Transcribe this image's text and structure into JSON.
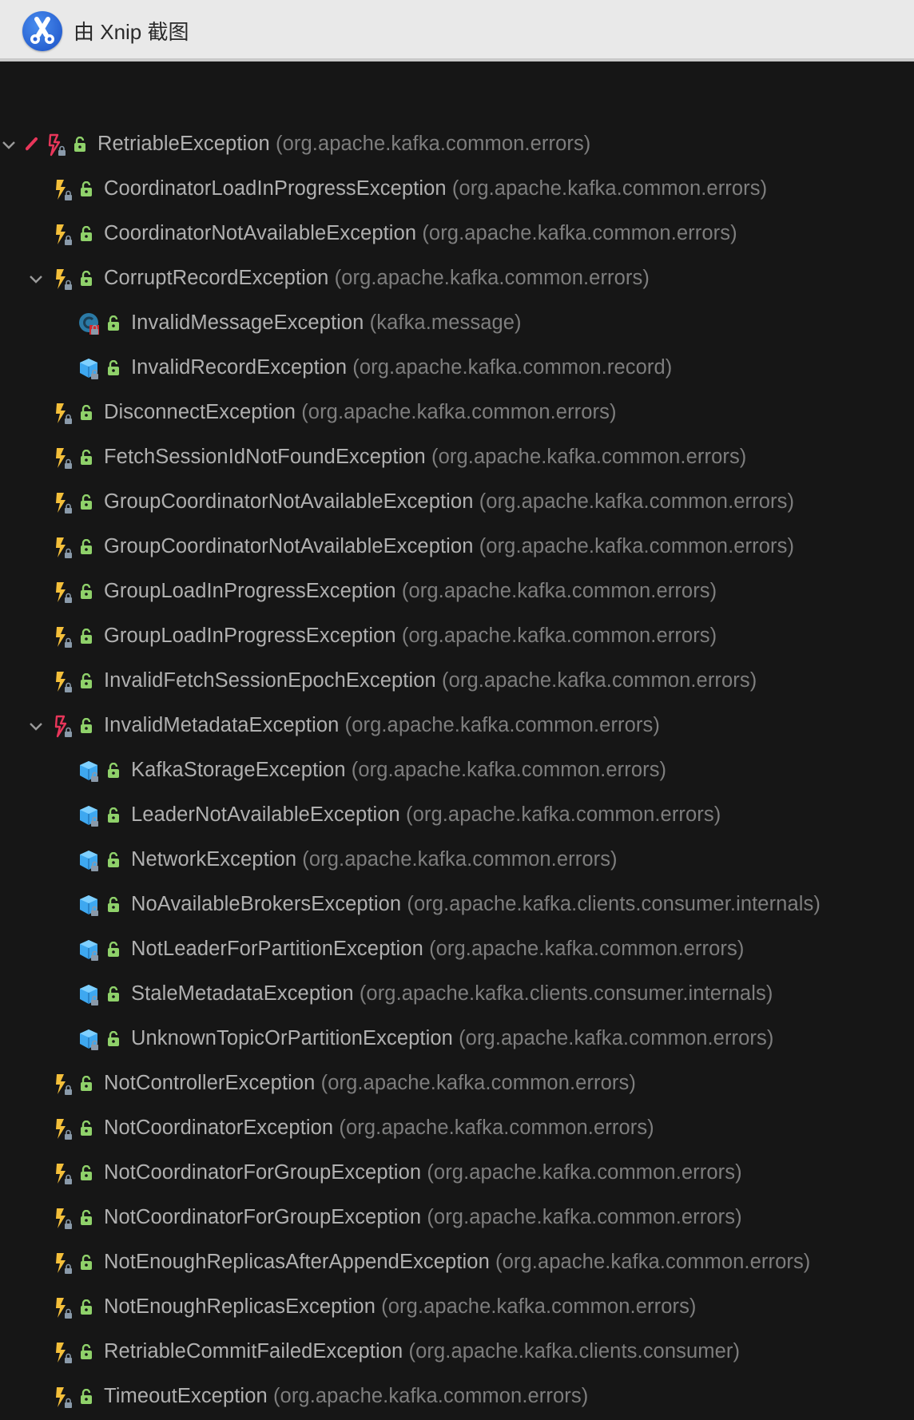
{
  "window": {
    "title": "由 Xnip 截图",
    "logo_icon": "xnip-scissors-icon"
  },
  "colors": {
    "exception_icon": "#f4bf3a",
    "root_exception_icon": "#e8365a",
    "class_icon": "#3ea8f0",
    "lock": "#8fd16a",
    "name_text": "#b0b0b0",
    "package_text": "#7e7e7e"
  },
  "rows": [
    {
      "level": 0,
      "expanded": true,
      "marker": "pencil",
      "icon": "exception-red",
      "name": "RetriableException",
      "pkg": "(org.apache.kafka.common.errors)"
    },
    {
      "level": 1,
      "icon": "exception",
      "name": "CoordinatorLoadInProgressException",
      "pkg": "(org.apache.kafka.common.errors)"
    },
    {
      "level": 1,
      "icon": "exception",
      "name": "CoordinatorNotAvailableException",
      "pkg": "(org.apache.kafka.common.errors)"
    },
    {
      "level": 1,
      "expanded": true,
      "icon": "exception",
      "name": "CorruptRecordException",
      "pkg": "(org.apache.kafka.common.errors)"
    },
    {
      "level": 2,
      "icon": "scala-class",
      "name": "InvalidMessageException",
      "pkg": "(kafka.message)"
    },
    {
      "level": 2,
      "icon": "class",
      "name": "InvalidRecordException",
      "pkg": "(org.apache.kafka.common.record)"
    },
    {
      "level": 1,
      "icon": "exception",
      "name": "DisconnectException",
      "pkg": "(org.apache.kafka.common.errors)"
    },
    {
      "level": 1,
      "icon": "exception",
      "name": "FetchSessionIdNotFoundException",
      "pkg": "(org.apache.kafka.common.errors)"
    },
    {
      "level": 1,
      "icon": "exception",
      "name": "GroupCoordinatorNotAvailableException",
      "pkg": "(org.apache.kafka.common.errors)"
    },
    {
      "level": 1,
      "icon": "exception",
      "name": "GroupCoordinatorNotAvailableException",
      "pkg": "(org.apache.kafka.common.errors)"
    },
    {
      "level": 1,
      "icon": "exception",
      "name": "GroupLoadInProgressException",
      "pkg": "(org.apache.kafka.common.errors)"
    },
    {
      "level": 1,
      "icon": "exception",
      "name": "GroupLoadInProgressException",
      "pkg": "(org.apache.kafka.common.errors)"
    },
    {
      "level": 1,
      "icon": "exception",
      "name": "InvalidFetchSessionEpochException",
      "pkg": "(org.apache.kafka.common.errors)"
    },
    {
      "level": 1,
      "expanded": true,
      "icon": "exception-red",
      "name": "InvalidMetadataException",
      "pkg": "(org.apache.kafka.common.errors)"
    },
    {
      "level": 2,
      "icon": "class",
      "name": "KafkaStorageException",
      "pkg": "(org.apache.kafka.common.errors)"
    },
    {
      "level": 2,
      "icon": "class",
      "name": "LeaderNotAvailableException",
      "pkg": "(org.apache.kafka.common.errors)"
    },
    {
      "level": 2,
      "icon": "class",
      "name": "NetworkException",
      "pkg": "(org.apache.kafka.common.errors)"
    },
    {
      "level": 2,
      "icon": "class",
      "name": "NoAvailableBrokersException",
      "pkg": "(org.apache.kafka.clients.consumer.internals)"
    },
    {
      "level": 2,
      "icon": "class",
      "name": "NotLeaderForPartitionException",
      "pkg": "(org.apache.kafka.common.errors)"
    },
    {
      "level": 2,
      "icon": "class",
      "name": "StaleMetadataException",
      "pkg": "(org.apache.kafka.clients.consumer.internals)"
    },
    {
      "level": 2,
      "icon": "class",
      "name": "UnknownTopicOrPartitionException",
      "pkg": "(org.apache.kafka.common.errors)"
    },
    {
      "level": 1,
      "icon": "exception",
      "name": "NotControllerException",
      "pkg": "(org.apache.kafka.common.errors)"
    },
    {
      "level": 1,
      "icon": "exception",
      "name": "NotCoordinatorException",
      "pkg": "(org.apache.kafka.common.errors)"
    },
    {
      "level": 1,
      "icon": "exception",
      "name": "NotCoordinatorForGroupException",
      "pkg": "(org.apache.kafka.common.errors)"
    },
    {
      "level": 1,
      "icon": "exception",
      "name": "NotCoordinatorForGroupException",
      "pkg": "(org.apache.kafka.common.errors)"
    },
    {
      "level": 1,
      "icon": "exception",
      "name": "NotEnoughReplicasAfterAppendException",
      "pkg": "(org.apache.kafka.common.errors)"
    },
    {
      "level": 1,
      "icon": "exception",
      "name": "NotEnoughReplicasException",
      "pkg": "(org.apache.kafka.common.errors)"
    },
    {
      "level": 1,
      "icon": "exception",
      "name": "RetriableCommitFailedException",
      "pkg": "(org.apache.kafka.clients.consumer)"
    },
    {
      "level": 1,
      "icon": "exception",
      "name": "TimeoutException",
      "pkg": "(org.apache.kafka.common.errors)"
    }
  ]
}
